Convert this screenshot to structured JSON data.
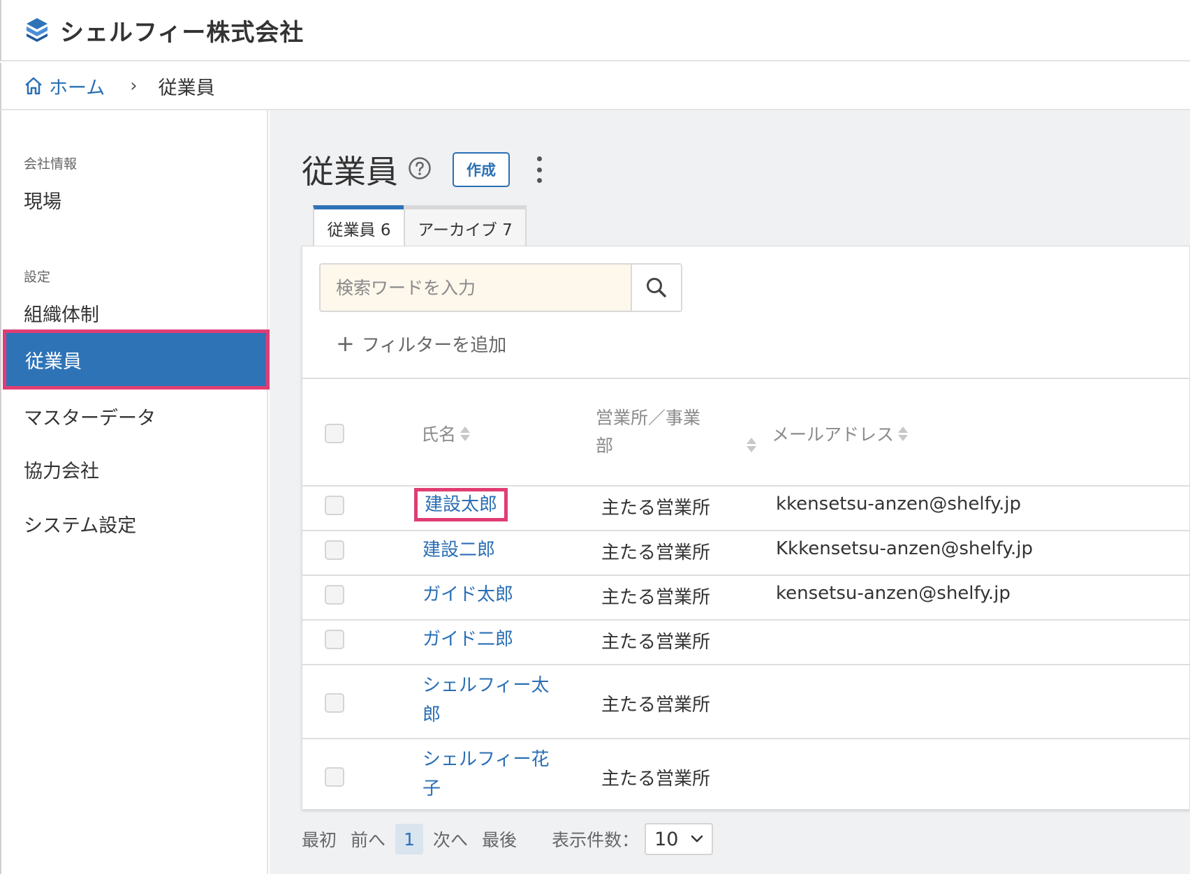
{
  "header": {
    "company_name": "シェルフィー株式会社",
    "logo_icon": "logo-icon",
    "brand_color": "#2f73b7"
  },
  "breadcrumb": {
    "home_label": "ホーム",
    "separator": "›",
    "current": "従業員"
  },
  "sidebar": {
    "section_company": "会社情報",
    "section_settings": "設定",
    "items": [
      {
        "label": "現場",
        "active": false
      },
      {
        "label": "組織体制",
        "active": false
      },
      {
        "label": "従業員",
        "active": true
      },
      {
        "label": "マスターデータ",
        "active": false
      },
      {
        "label": "協力会社",
        "active": false
      },
      {
        "label": "システム設定",
        "active": false
      }
    ],
    "highlight_color": "#e03d72"
  },
  "main": {
    "title": "従業員",
    "create_label": "作成",
    "tabs": [
      {
        "label": "従業員 6",
        "active": true
      },
      {
        "label": "アーカイブ 7",
        "active": false
      }
    ],
    "search": {
      "placeholder": "検索ワードを入力",
      "value": ""
    },
    "add_filter_label": "フィルターを追加",
    "table": {
      "columns": [
        "氏名",
        "営業所／事業部",
        "メールアドレス"
      ],
      "rows": [
        {
          "name": "建設太郎",
          "office": "主たる営業所",
          "email": "kkensetsu-anzen@shelfy.jp"
        },
        {
          "name": "建設二郎",
          "office": "主たる営業所",
          "email": "Kkkensetsu-anzen@shelfy.jp"
        },
        {
          "name": "ガイド太郎",
          "office": "主たる営業所",
          "email": "kensetsu-anzen@shelfy.jp"
        },
        {
          "name": "ガイド二郎",
          "office": "主たる営業所",
          "email": ""
        },
        {
          "name": "シェルフィー太郎",
          "office": "主たる営業所",
          "email": ""
        },
        {
          "name": "シェルフィー花子",
          "office": "主たる営業所",
          "email": ""
        }
      ]
    },
    "pager": {
      "first": "最初",
      "prev": "前へ",
      "current_page": "1",
      "next": "次へ",
      "last": "最後",
      "page_size_label": "表示件数：",
      "page_size": "10"
    }
  }
}
